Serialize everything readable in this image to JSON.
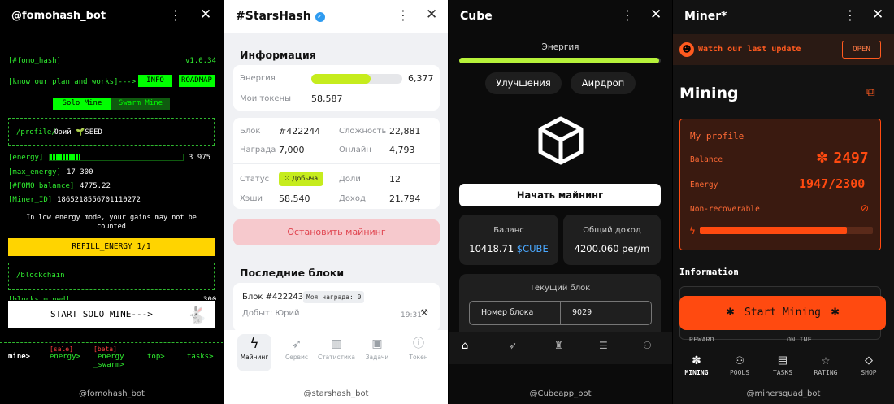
{
  "p1": {
    "title": "@fomohash_bot",
    "tag": "[#fomo_hash]",
    "version": "v1.0.34",
    "know_link": "[know_our_plan_and_works]--->",
    "info_btn": "INFO",
    "roadmap_btn": "ROADMAP",
    "solo_tab": "Solo_Mine",
    "swarm_tab": "Swarm_Mine",
    "profile_label": "/profile/",
    "profile_name": "Юрий 🌱SEED",
    "energy_label": "[energy]",
    "energy_value": "3 975",
    "energy_fill": 0.23,
    "max_energy_label": "[max_energy]",
    "max_energy_value": "17 300",
    "balance_label": "[#FOMO_balance]",
    "balance_value": "4775.22",
    "miner_label": "[Miner_ID]",
    "miner_value": "1865218556701110272",
    "low_energy_note": "In low energy mode, your gains may not be counted",
    "refill_btn": "REFILL_ENERGY 1/1",
    "blockchain_label": "/blockchain",
    "blocks_mined_partial": "[blocks_mined]",
    "blocks_mined_value_partial": "300",
    "start_btn": "START_SOLO_MINE--->",
    "nav_mine": "mine>",
    "nav_sale_badge": "[sale]",
    "nav_energy": "energy>",
    "nav_beta_badge": "[beta]",
    "nav_swarm_1": "energy",
    "nav_swarm_2": "_swarm>",
    "nav_top": "top>",
    "nav_tasks": "tasks>",
    "footer": "@fomohash_bot"
  },
  "p2": {
    "title": "#StarsHash",
    "info_title": "Информация",
    "energy_label": "Энергия",
    "energy_value": "6,377",
    "energy_fill": 0.65,
    "tokens_label": "Мои токены",
    "tokens_value": "58,587",
    "block_label": "Блок",
    "block_value": "#422244",
    "complexity_label": "Сложность",
    "complexity_value": "22,881",
    "reward_label": "Награда",
    "reward_value": "7,000",
    "online_label": "Онлайн",
    "online_value": "4,793",
    "status_label": "Статус",
    "status_badge": "Добыча",
    "shares_label": "Доли",
    "shares_value": "12",
    "hashes_label": "Хэши",
    "hashes_value": "58,540",
    "income_label": "Доход",
    "income_value": "21.794",
    "stop_btn": "Остановить майнинг",
    "recent_title": "Последние блоки",
    "recent_block": "Блок #422243",
    "my_reward": "Моя награда: 0",
    "mined_by": "Добыт: Юрий",
    "mined_time": "19:31",
    "nav": [
      "Майнинг",
      "Сервис",
      "Статистика",
      "Задачи",
      "Токен"
    ],
    "footer": "@starshash_bot",
    "accent": "#c6ec1d"
  },
  "p3": {
    "title": "Cube",
    "energy_label": "Энергия",
    "energy_fill": 0.99,
    "upgrades_btn": "Улучшения",
    "airdrop_btn": "Аирдроп",
    "start_btn": "Начать майнинг",
    "balance_label": "Баланс",
    "balance_value": "10418.71",
    "balance_token": "$CUBE",
    "income_label": "Общий доход",
    "income_value": "4200.060 per/m",
    "current_block_label": "Текущий блок",
    "block_number_label": "Номер блока",
    "block_number_value": "9029",
    "footer": "@Cubeapp_bot",
    "accent": "#b7f23a"
  },
  "p4": {
    "title": "Miner*",
    "banner_text": "Watch our last update",
    "open_btn": "OPEN",
    "mining_title": "Mining",
    "profile_title": "My profile",
    "balance_label": "Balance",
    "balance_value": "2497",
    "energy_label": "Energy",
    "energy_value": "1947/2300",
    "energy_fill": 0.85,
    "nonrec_label": "Non-recoverable",
    "info_title": "Information",
    "start_btn": "Start Mining",
    "partial_reward": "REWARD",
    "partial_online": "ONLINE",
    "nav": [
      "MINING",
      "POOLS",
      "TASKS",
      "RATING",
      "SHOP"
    ],
    "footer": "@minersquad_bot",
    "accent": "#ff4a10"
  }
}
